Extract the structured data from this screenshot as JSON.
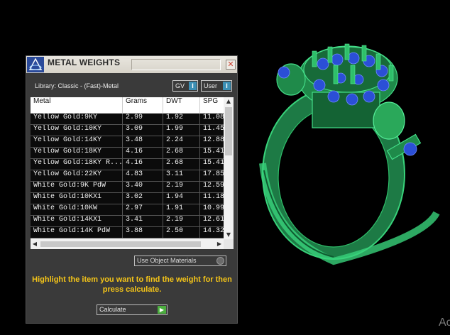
{
  "panel": {
    "title": "METAL WEIGHTS",
    "close_icon": "close-icon",
    "library_label": "Library: Classic - (Fast)-Metal",
    "gv_label": "GV",
    "user_label": "User",
    "toggle_glyph": "I",
    "use_object_materials_label": "Use Object Materials",
    "hint": "Highlight the item you want to find the weight for then press calculate.",
    "calculate_label": "Calculate",
    "calculate_icon": "play-icon",
    "accent_color": "#f5c518"
  },
  "table": {
    "columns": [
      "Metal",
      "Grams",
      "DWT",
      "SPG"
    ],
    "rows": [
      [
        "Yellow Gold:9KY",
        "2.99",
        "1.92",
        "11.08"
      ],
      [
        "Yellow Gold:10KY",
        "3.09",
        "1.99",
        "11.45"
      ],
      [
        "Yellow Gold:14KY",
        "3.48",
        "2.24",
        "12.88"
      ],
      [
        "Yellow Gold:18KY",
        "4.16",
        "2.68",
        "15.41"
      ],
      [
        "Yellow Gold:18KY R...",
        "4.16",
        "2.68",
        "15.41"
      ],
      [
        "Yellow Gold:22KY",
        "4.83",
        "3.11",
        "17.85"
      ],
      [
        "White Gold:9K PdW",
        "3.40",
        "2.19",
        "12.59"
      ],
      [
        "White Gold:10KX1",
        "3.02",
        "1.94",
        "11.18"
      ],
      [
        "White Gold:10KW",
        "2.97",
        "1.91",
        "10.99"
      ],
      [
        "White Gold:14KX1",
        "3.41",
        "2.19",
        "12.61"
      ],
      [
        "White Gold:14K PdW",
        "3.88",
        "2.50",
        "14.32"
      ]
    ]
  },
  "viewport": {
    "model_color": "#1f8a4a",
    "gem_color": "#2b4fd6",
    "watermark": "Ac"
  }
}
